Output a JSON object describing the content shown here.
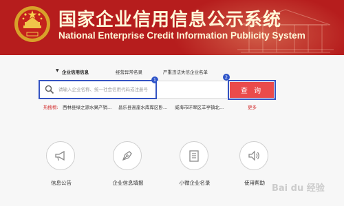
{
  "header": {
    "title_cn": "国家企业信用信息公示系统",
    "title_en": "National Enterprise Credit Information Publicity System"
  },
  "tabs": [
    {
      "label": "企业信用信息",
      "active": true
    },
    {
      "label": "经营异常名录",
      "active": false
    },
    {
      "label": "严重违法失信企业名单",
      "active": false
    }
  ],
  "badges": [
    "1",
    "2"
  ],
  "search": {
    "placeholder": "请输入企业名称、统一社会信用代码或注册号",
    "value": "",
    "button_label": "查 询"
  },
  "hot_search": {
    "label": "热搜榜:",
    "items": [
      "西林县绿之源水果产销...",
      "昌乐县高崖水库库区卧...",
      "威海市环翠区羊亭镇北..."
    ],
    "more": "更多"
  },
  "services": [
    {
      "label": "信息公告",
      "icon": "megaphone-icon"
    },
    {
      "label": "企业信息填报",
      "icon": "pen-nib-icon"
    },
    {
      "label": "小微企业名录",
      "icon": "document-list-icon"
    },
    {
      "label": "使用帮助",
      "icon": "speaker-icon"
    }
  ],
  "watermark": "Bai du 经验",
  "colors": {
    "header_red": "#b61d1d",
    "title_cream": "#fff7d8",
    "button_red": "#ea4b4b",
    "highlight_blue": "#3453c2",
    "hot_red": "#d22c2c"
  }
}
